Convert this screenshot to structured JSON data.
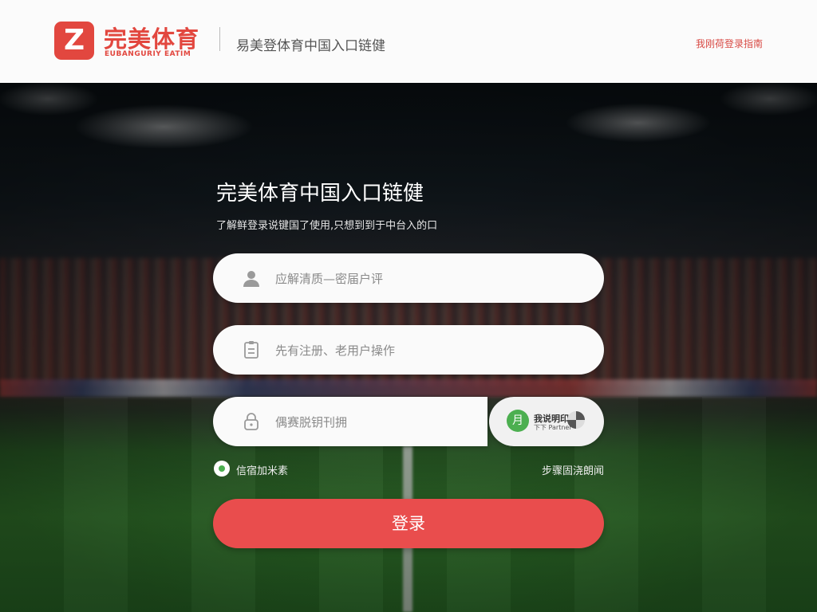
{
  "header": {
    "logo_glyph": "Z",
    "brand_name": "完美体育",
    "brand_en": "EUBANGURIY EATIM",
    "title": "易美登体育中国入口链健",
    "top_right_link": "我刚荷登录指南"
  },
  "login": {
    "title": "完美体育中国入口链健",
    "subtitle": "了解鲜登录说键国了使用,只想到到于中台入的口",
    "username": {
      "placeholder": "应解清质—密届户评",
      "icon": "user-icon"
    },
    "register": {
      "placeholder": "先有注册、老用户操作",
      "icon": "id-card-icon"
    },
    "password": {
      "placeholder": "偶赛脱钥刊拥",
      "icon": "lock-icon"
    },
    "captcha": {
      "line1": "我说明印",
      "line2": "下下 Partner",
      "badge_glyph": "月"
    },
    "remember_label": "信宿加米素",
    "forgot_label": "步骤固浇朗闻",
    "submit_label": "登录"
  },
  "colors": {
    "accent": "#e2473f",
    "button": "#e94d4d",
    "success": "#4caf50"
  }
}
